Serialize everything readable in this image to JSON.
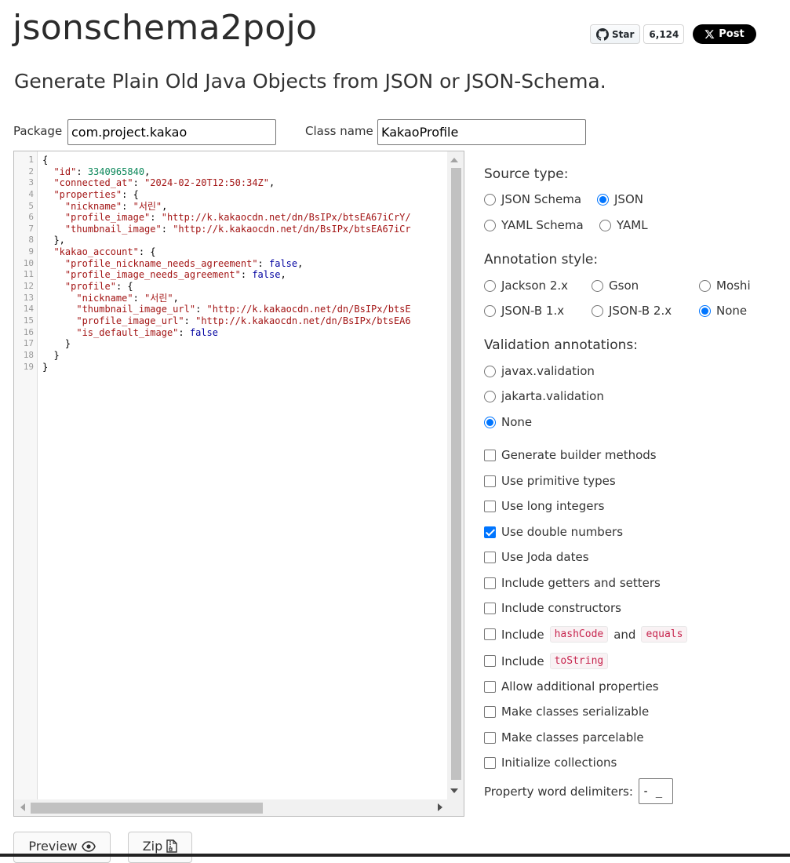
{
  "header": {
    "title": "jsonschema2pojo",
    "subtitle": "Generate Plain Old Java Objects from JSON or JSON-Schema.",
    "github_star_label": "Star",
    "github_star_count": "6,124",
    "x_post_label": "Post"
  },
  "form": {
    "package_label": "Package",
    "package_value": "com.project.kakao",
    "class_name_label": "Class name",
    "class_name_value": "KakaoProfile"
  },
  "editor": {
    "line_numbers": [
      "1",
      "2",
      "3",
      "4",
      "5",
      "6",
      "7",
      "8",
      "9",
      "10",
      "11",
      "12",
      "13",
      "14",
      "15",
      "16",
      "17",
      "18",
      "19"
    ],
    "lines": [
      [
        {
          "t": "p",
          "v": "{"
        }
      ],
      [
        {
          "t": "p",
          "v": "  "
        },
        {
          "t": "k",
          "v": "\"id\""
        },
        {
          "t": "p",
          "v": ": "
        },
        {
          "t": "n",
          "v": "3340965840"
        },
        {
          "t": "p",
          "v": ","
        }
      ],
      [
        {
          "t": "p",
          "v": "  "
        },
        {
          "t": "k",
          "v": "\"connected_at\""
        },
        {
          "t": "p",
          "v": ": "
        },
        {
          "t": "s",
          "v": "\"2024-02-20T12:50:34Z\""
        },
        {
          "t": "p",
          "v": ","
        }
      ],
      [
        {
          "t": "p",
          "v": "  "
        },
        {
          "t": "k",
          "v": "\"properties\""
        },
        {
          "t": "p",
          "v": ": {"
        }
      ],
      [
        {
          "t": "p",
          "v": "    "
        },
        {
          "t": "k",
          "v": "\"nickname\""
        },
        {
          "t": "p",
          "v": ": "
        },
        {
          "t": "s",
          "v": "\"서린\""
        },
        {
          "t": "p",
          "v": ","
        }
      ],
      [
        {
          "t": "p",
          "v": "    "
        },
        {
          "t": "k",
          "v": "\"profile_image\""
        },
        {
          "t": "p",
          "v": ": "
        },
        {
          "t": "s",
          "v": "\"http://k.kakaocdn.net/dn/BsIPx/btsEA67iCrY/"
        }
      ],
      [
        {
          "t": "p",
          "v": "    "
        },
        {
          "t": "k",
          "v": "\"thumbnail_image\""
        },
        {
          "t": "p",
          "v": ": "
        },
        {
          "t": "s",
          "v": "\"http://k.kakaocdn.net/dn/BsIPx/btsEA67iCr"
        }
      ],
      [
        {
          "t": "p",
          "v": "  },"
        }
      ],
      [
        {
          "t": "p",
          "v": "  "
        },
        {
          "t": "k",
          "v": "\"kakao_account\""
        },
        {
          "t": "p",
          "v": ": {"
        }
      ],
      [
        {
          "t": "p",
          "v": "    "
        },
        {
          "t": "k",
          "v": "\"profile_nickname_needs_agreement\""
        },
        {
          "t": "p",
          "v": ": "
        },
        {
          "t": "b",
          "v": "false"
        },
        {
          "t": "p",
          "v": ","
        }
      ],
      [
        {
          "t": "p",
          "v": "    "
        },
        {
          "t": "k",
          "v": "\"profile_image_needs_agreement\""
        },
        {
          "t": "p",
          "v": ": "
        },
        {
          "t": "b",
          "v": "false"
        },
        {
          "t": "p",
          "v": ","
        }
      ],
      [
        {
          "t": "p",
          "v": "    "
        },
        {
          "t": "k",
          "v": "\"profile\""
        },
        {
          "t": "p",
          "v": ": {"
        }
      ],
      [
        {
          "t": "p",
          "v": "      "
        },
        {
          "t": "k",
          "v": "\"nickname\""
        },
        {
          "t": "p",
          "v": ": "
        },
        {
          "t": "s",
          "v": "\"서린\""
        },
        {
          "t": "p",
          "v": ","
        }
      ],
      [
        {
          "t": "p",
          "v": "      "
        },
        {
          "t": "k",
          "v": "\"thumbnail_image_url\""
        },
        {
          "t": "p",
          "v": ": "
        },
        {
          "t": "s",
          "v": "\"http://k.kakaocdn.net/dn/BsIPx/btsE"
        }
      ],
      [
        {
          "t": "p",
          "v": "      "
        },
        {
          "t": "k",
          "v": "\"profile_image_url\""
        },
        {
          "t": "p",
          "v": ": "
        },
        {
          "t": "s",
          "v": "\"http://k.kakaocdn.net/dn/BsIPx/btsEA6"
        }
      ],
      [
        {
          "t": "p",
          "v": "      "
        },
        {
          "t": "k",
          "v": "\"is_default_image\""
        },
        {
          "t": "p",
          "v": ": "
        },
        {
          "t": "b",
          "v": "false"
        }
      ],
      [
        {
          "t": "p",
          "v": "    }"
        }
      ],
      [
        {
          "t": "p",
          "v": "  }"
        }
      ],
      [
        {
          "t": "p",
          "v": "}"
        }
      ]
    ]
  },
  "source_type": {
    "heading": "Source type:",
    "options": [
      {
        "label": "JSON Schema",
        "selected": false
      },
      {
        "label": "JSON",
        "selected": true
      },
      {
        "label": "YAML Schema",
        "selected": false
      },
      {
        "label": "YAML",
        "selected": false
      }
    ]
  },
  "annotation_style": {
    "heading": "Annotation style:",
    "options": [
      {
        "label": "Jackson 2.x",
        "selected": false
      },
      {
        "label": "Gson",
        "selected": false
      },
      {
        "label": "Moshi",
        "selected": false
      },
      {
        "label": "JSON-B 1.x",
        "selected": false
      },
      {
        "label": "JSON-B 2.x",
        "selected": false
      },
      {
        "label": "None",
        "selected": true
      }
    ]
  },
  "validation": {
    "heading": "Validation annotations:",
    "options": [
      {
        "label": "javax.validation",
        "selected": false
      },
      {
        "label": "jakarta.validation",
        "selected": false
      },
      {
        "label": "None",
        "selected": true
      }
    ]
  },
  "checkboxes": [
    {
      "label": "Generate builder methods",
      "checked": false
    },
    {
      "label": "Use primitive types",
      "checked": false
    },
    {
      "label": "Use long integers",
      "checked": false
    },
    {
      "label": "Use double numbers",
      "checked": true
    },
    {
      "label": "Use Joda dates",
      "checked": false
    },
    {
      "label": "Include getters and setters",
      "checked": false
    },
    {
      "label": "Include constructors",
      "checked": false
    },
    {
      "label": "Allow additional properties",
      "checked": false
    },
    {
      "label": "Make classes serializable",
      "checked": false
    },
    {
      "label": "Make classes parcelable",
      "checked": false
    },
    {
      "label": "Initialize collections",
      "checked": false
    }
  ],
  "hashcode_option": {
    "prefix": "Include",
    "code1": "hashCode",
    "joiner": "and",
    "code2": "equals",
    "checked": false
  },
  "tostring_option": {
    "prefix": "Include",
    "code": "toString",
    "checked": false
  },
  "delimiters": {
    "label": "Property word delimiters:",
    "value": "- _"
  },
  "buttons": {
    "preview": "Preview",
    "zip": "Zip"
  },
  "colors": {
    "accent": "#0075ff",
    "code_string": "#a31515",
    "code_number": "#098658",
    "code_bool": "#0000a0"
  }
}
